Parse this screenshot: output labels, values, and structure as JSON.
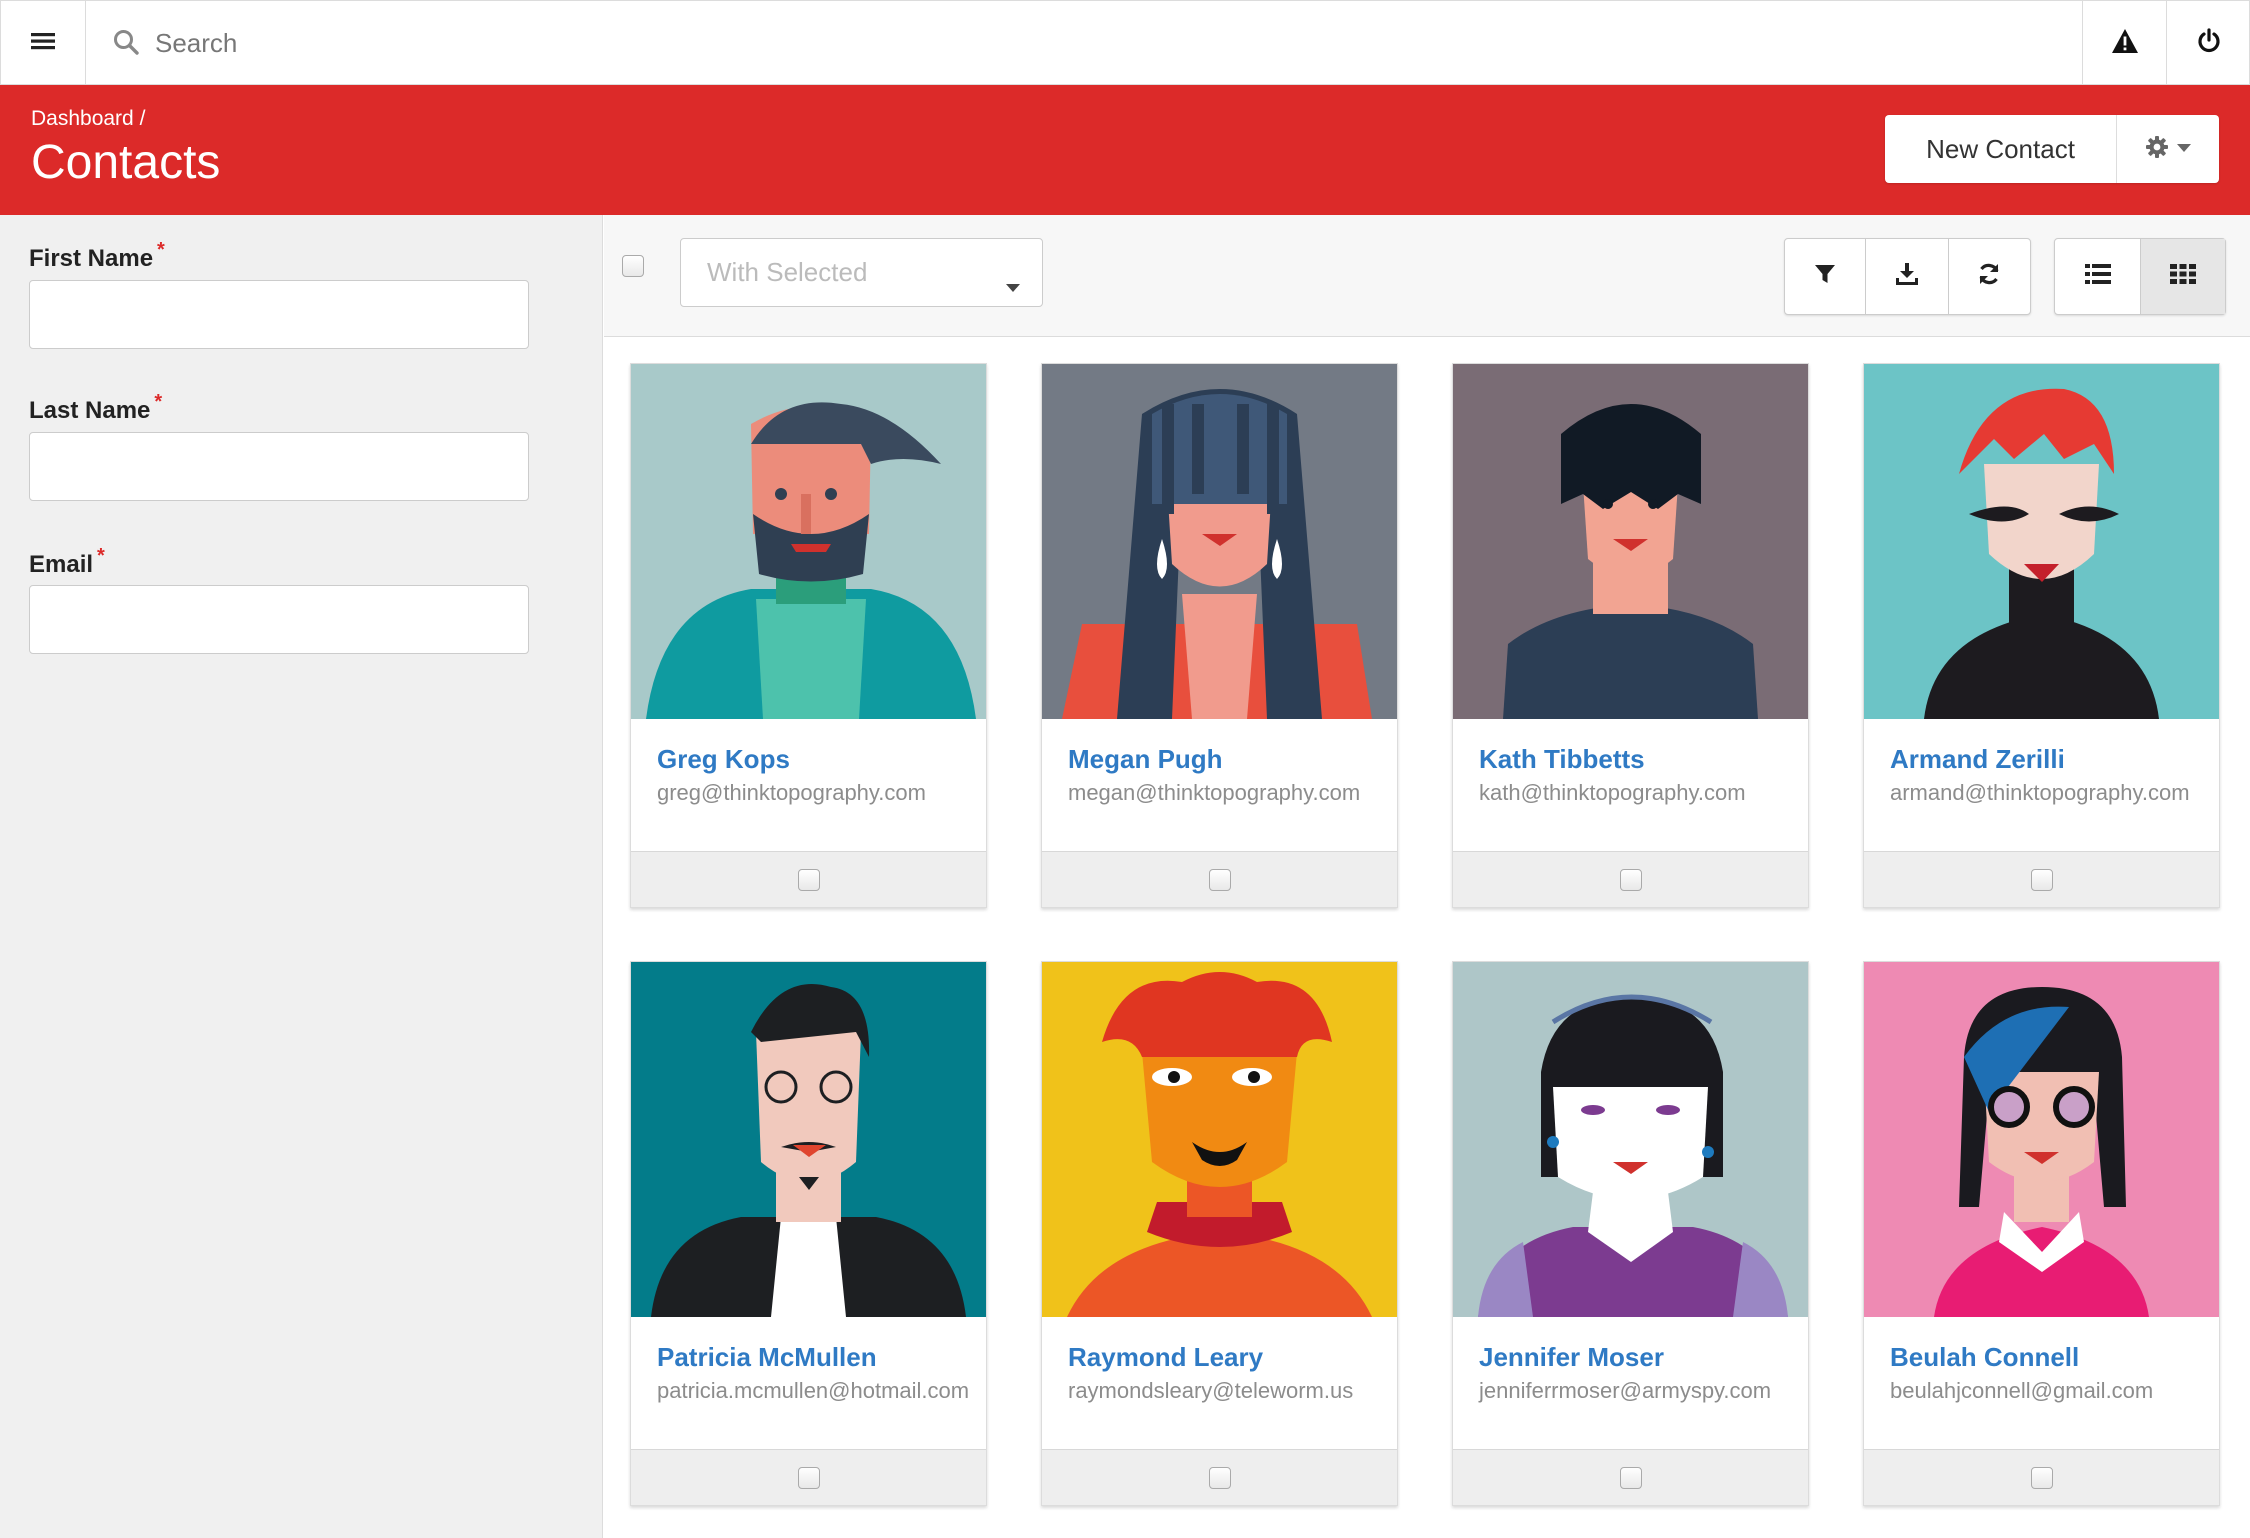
{
  "search": {
    "placeholder": "Search"
  },
  "header": {
    "breadcrumb": "Dashboard /",
    "title": "Contacts",
    "new_contact_label": "New Contact"
  },
  "form": {
    "first_name_label": "First Name",
    "last_name_label": "Last Name",
    "email_label": "Email",
    "required_mark": "*"
  },
  "toolbar": {
    "with_selected": "With Selected"
  },
  "colors": {
    "brand": "#dc2a29",
    "link": "#2f7ac4"
  },
  "contacts": [
    {
      "name": "Greg Kops",
      "email": "greg@thinktopography.com",
      "bg": "#a8c9c9"
    },
    {
      "name": "Megan Pugh",
      "email": "megan@thinktopography.com",
      "bg": "#737a85"
    },
    {
      "name": "Kath Tibbetts",
      "email": "kath@thinktopography.com",
      "bg": "#7a6c75"
    },
    {
      "name": "Armand Zerilli",
      "email": "armand@thinktopography.com",
      "bg": "#6cc4c6"
    },
    {
      "name": "Patricia McMullen",
      "email": "patricia.mcmullen@hotmail.com",
      "bg": "#037c8a"
    },
    {
      "name": "Raymond Leary",
      "email": "raymondsleary@teleworm.us",
      "bg": "#f0c21a"
    },
    {
      "name": "Jennifer Moser",
      "email": "jenniferrmoser@armyspy.com",
      "bg": "#aec6c8"
    },
    {
      "name": "Beulah Connell",
      "email": "beulahjconnell@gmail.com",
      "bg": "#ee8ab3"
    }
  ]
}
